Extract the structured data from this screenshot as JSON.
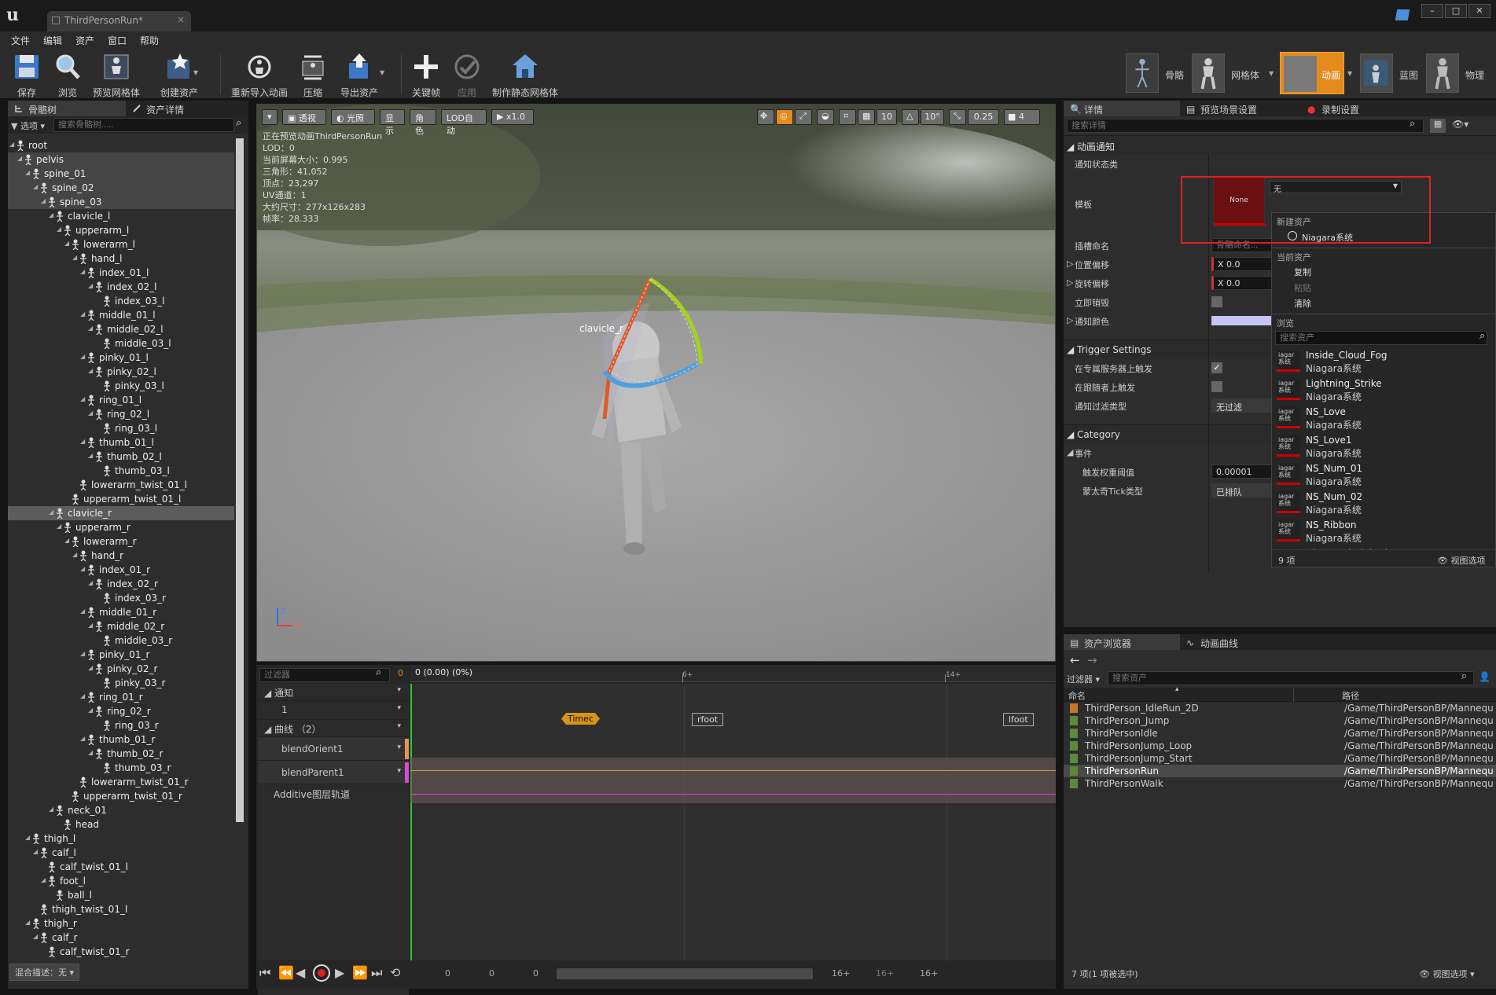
{
  "window": {
    "tab_title": "ThirdPersonRun*",
    "min": "–",
    "max": "□",
    "close": "✕"
  },
  "menu": [
    "文件",
    "编辑",
    "资产",
    "窗口",
    "帮助"
  ],
  "toolbar": {
    "left": [
      "保存",
      "浏览",
      "预览网格体",
      "创建资产",
      "重新导入动画",
      "压缩",
      "导出资产",
      "关键帧",
      "应用",
      "制作静态网格体"
    ],
    "modes": [
      "骨骼",
      "网格体",
      "动画",
      "蓝图",
      "物理"
    ]
  },
  "left_panel": {
    "tabs": [
      "骨骼树",
      "资产详情"
    ],
    "options_label": "选项",
    "search_placeholder": "搜索骨骼树.....",
    "bones": [
      {
        "name": "root",
        "d": 0,
        "e": 1
      },
      {
        "name": "pelvis",
        "d": 1,
        "e": 1,
        "hl": 1
      },
      {
        "name": "spine_01",
        "d": 2,
        "e": 1,
        "hl": 1
      },
      {
        "name": "spine_02",
        "d": 3,
        "e": 1,
        "hl": 1
      },
      {
        "name": "spine_03",
        "d": 4,
        "e": 1,
        "hl": 1
      },
      {
        "name": "clavicle_l",
        "d": 5,
        "e": 1
      },
      {
        "name": "upperarm_l",
        "d": 6,
        "e": 1
      },
      {
        "name": "lowerarm_l",
        "d": 7,
        "e": 1
      },
      {
        "name": "hand_l",
        "d": 8,
        "e": 1
      },
      {
        "name": "index_01_l",
        "d": 9,
        "e": 1
      },
      {
        "name": "index_02_l",
        "d": 10,
        "e": 1
      },
      {
        "name": "index_03_l",
        "d": 11,
        "e": 0
      },
      {
        "name": "middle_01_l",
        "d": 9,
        "e": 1
      },
      {
        "name": "middle_02_l",
        "d": 10,
        "e": 1
      },
      {
        "name": "middle_03_l",
        "d": 11,
        "e": 0
      },
      {
        "name": "pinky_01_l",
        "d": 9,
        "e": 1
      },
      {
        "name": "pinky_02_l",
        "d": 10,
        "e": 1
      },
      {
        "name": "pinky_03_l",
        "d": 11,
        "e": 0
      },
      {
        "name": "ring_01_l",
        "d": 9,
        "e": 1
      },
      {
        "name": "ring_02_l",
        "d": 10,
        "e": 1
      },
      {
        "name": "ring_03_l",
        "d": 11,
        "e": 0
      },
      {
        "name": "thumb_01_l",
        "d": 9,
        "e": 1
      },
      {
        "name": "thumb_02_l",
        "d": 10,
        "e": 1
      },
      {
        "name": "thumb_03_l",
        "d": 11,
        "e": 0
      },
      {
        "name": "lowerarm_twist_01_l",
        "d": 8,
        "e": 0
      },
      {
        "name": "upperarm_twist_01_l",
        "d": 7,
        "e": 0
      },
      {
        "name": "clavicle_r",
        "d": 5,
        "e": 1,
        "sel": 1
      },
      {
        "name": "upperarm_r",
        "d": 6,
        "e": 1
      },
      {
        "name": "lowerarm_r",
        "d": 7,
        "e": 1
      },
      {
        "name": "hand_r",
        "d": 8,
        "e": 1
      },
      {
        "name": "index_01_r",
        "d": 9,
        "e": 1
      },
      {
        "name": "index_02_r",
        "d": 10,
        "e": 1
      },
      {
        "name": "index_03_r",
        "d": 11,
        "e": 0
      },
      {
        "name": "middle_01_r",
        "d": 9,
        "e": 1
      },
      {
        "name": "middle_02_r",
        "d": 10,
        "e": 1
      },
      {
        "name": "middle_03_r",
        "d": 11,
        "e": 0
      },
      {
        "name": "pinky_01_r",
        "d": 9,
        "e": 1
      },
      {
        "name": "pinky_02_r",
        "d": 10,
        "e": 1
      },
      {
        "name": "pinky_03_r",
        "d": 11,
        "e": 0
      },
      {
        "name": "ring_01_r",
        "d": 9,
        "e": 1
      },
      {
        "name": "ring_02_r",
        "d": 10,
        "e": 1
      },
      {
        "name": "ring_03_r",
        "d": 11,
        "e": 0
      },
      {
        "name": "thumb_01_r",
        "d": 9,
        "e": 1
      },
      {
        "name": "thumb_02_r",
        "d": 10,
        "e": 1
      },
      {
        "name": "thumb_03_r",
        "d": 11,
        "e": 0
      },
      {
        "name": "lowerarm_twist_01_r",
        "d": 8,
        "e": 0
      },
      {
        "name": "upperarm_twist_01_r",
        "d": 7,
        "e": 0
      },
      {
        "name": "neck_01",
        "d": 5,
        "e": 1
      },
      {
        "name": "head",
        "d": 6,
        "e": 0
      },
      {
        "name": "thigh_l",
        "d": 2,
        "e": 1
      },
      {
        "name": "calf_l",
        "d": 3,
        "e": 1
      },
      {
        "name": "calf_twist_01_l",
        "d": 4,
        "e": 0
      },
      {
        "name": "foot_l",
        "d": 4,
        "e": 1
      },
      {
        "name": "ball_l",
        "d": 5,
        "e": 0
      },
      {
        "name": "thigh_twist_01_l",
        "d": 3,
        "e": 0
      },
      {
        "name": "thigh_r",
        "d": 2,
        "e": 1
      },
      {
        "name": "calf_r",
        "d": 3,
        "e": 1
      },
      {
        "name": "calf_twist_01_r",
        "d": 4,
        "e": 0
      }
    ],
    "footer": "混合描述：无"
  },
  "viewport": {
    "buttons": [
      "透视",
      "光照",
      "显示",
      "角色",
      "LOD自动",
      "x1.0"
    ],
    "right_values": [
      "10",
      "10°",
      "0.25",
      "4"
    ],
    "stats": [
      "正在预览动画ThirdPersonRun",
      "LOD：0",
      "当前屏幕大小：0.995",
      "三角形：41,052",
      "顶点：23,297",
      "UV通道：1",
      "大约尺寸：277x126x283",
      "帧率：28.333"
    ],
    "bone_label": "clavicle_r",
    "axis_z": "Z",
    "axis_x": "X"
  },
  "timeline": {
    "filter_placeholder": "过滤器",
    "frame": "0",
    "position": "0 (0.00) (0%)",
    "ticks": [
      "6+",
      "14+"
    ],
    "tracks": [
      "通知",
      "1",
      "曲线 （2）",
      "blendOrient1",
      "blendParent1",
      "Additive图层轨道"
    ],
    "notifies": [
      "Timec",
      "rfoot",
      "lfoot"
    ],
    "bottom": [
      "0",
      "0",
      "0",
      "16+",
      "16+",
      "16+"
    ]
  },
  "details": {
    "tabs": [
      "详情",
      "预览场景设置",
      "录制设置"
    ],
    "search_placeholder": "搜索详情",
    "sections": {
      "anim_notify": "动画通知",
      "trigger": "Trigger Settings",
      "category": "Category",
      "event": "事件"
    },
    "props": {
      "notify_state": "通知状态类",
      "template": "模板",
      "template_thumb": "None",
      "template_value": "无",
      "socket": "插槽命名",
      "socket_ph": "骨骼命名...",
      "loc": "位置偏移",
      "loc_v": "X 0.0",
      "rot": "旋转偏移",
      "rot_v": "X 0.0",
      "destroy": "立即销毁",
      "color": "通知颜色",
      "server": "在专属服务器上触发",
      "follower": "在跟随者上触发",
      "filter": "通知过滤类型",
      "filter_v": "无过滤",
      "weight": "触发权重阈值",
      "weight_v": "0.00001",
      "tick": "蒙太奇Tick类型",
      "tick_v": "已排队"
    }
  },
  "dropdown": {
    "new_asset": "新建资产",
    "niagara_system": "Niagara系统",
    "current_asset": "当前资产",
    "copy": "复制",
    "paste": "粘贴",
    "clear": "清除",
    "browse": "浏览",
    "search_placeholder": "搜索资产",
    "assets": [
      {
        "name": "Inside_Cloud_Fog",
        "type": "Niagara系统"
      },
      {
        "name": "Lightning_Strike",
        "type": "Niagara系统"
      },
      {
        "name": "NS_Love",
        "type": "Niagara系统"
      },
      {
        "name": "NS_Love1",
        "type": "Niagara系统"
      },
      {
        "name": "NS_Num_01",
        "type": "Niagara系统"
      },
      {
        "name": "NS_Num_02",
        "type": "Niagara系统"
      },
      {
        "name": "NS_Ribbon",
        "type": "Niagara系统"
      },
      {
        "name": "Obscured_Lightning",
        "type": ""
      }
    ],
    "thumb_text": "iagar 系统",
    "count": "9 项",
    "view_options": "视图选项"
  },
  "browser": {
    "tabs": [
      "资产浏览器",
      "动画曲线"
    ],
    "filter": "过滤器",
    "search_placeholder": "搜索资产",
    "col_name": "命名",
    "col_path": "路径",
    "rows": [
      {
        "name": "ThirdPerson_IdleRun_2D",
        "path": "/Game/ThirdPersonBP/Mannequ"
      },
      {
        "name": "ThirdPerson_Jump",
        "path": "/Game/ThirdPersonBP/Mannequ"
      },
      {
        "name": "ThirdPersonIdle",
        "path": "/Game/ThirdPersonBP/Mannequ"
      },
      {
        "name": "ThirdPersonJump_Loop",
        "path": "/Game/ThirdPersonBP/Mannequ"
      },
      {
        "name": "ThirdPersonJump_Start",
        "path": "/Game/ThirdPersonBP/Mannequ"
      },
      {
        "name": "ThirdPersonRun",
        "path": "/Game/ThirdPersonBP/Mannequ"
      },
      {
        "name": "ThirdPersonWalk",
        "path": "/Game/ThirdPersonBP/Mannequ"
      }
    ],
    "status": "7 项(1 项被选中)",
    "view_options": "视图选项"
  }
}
